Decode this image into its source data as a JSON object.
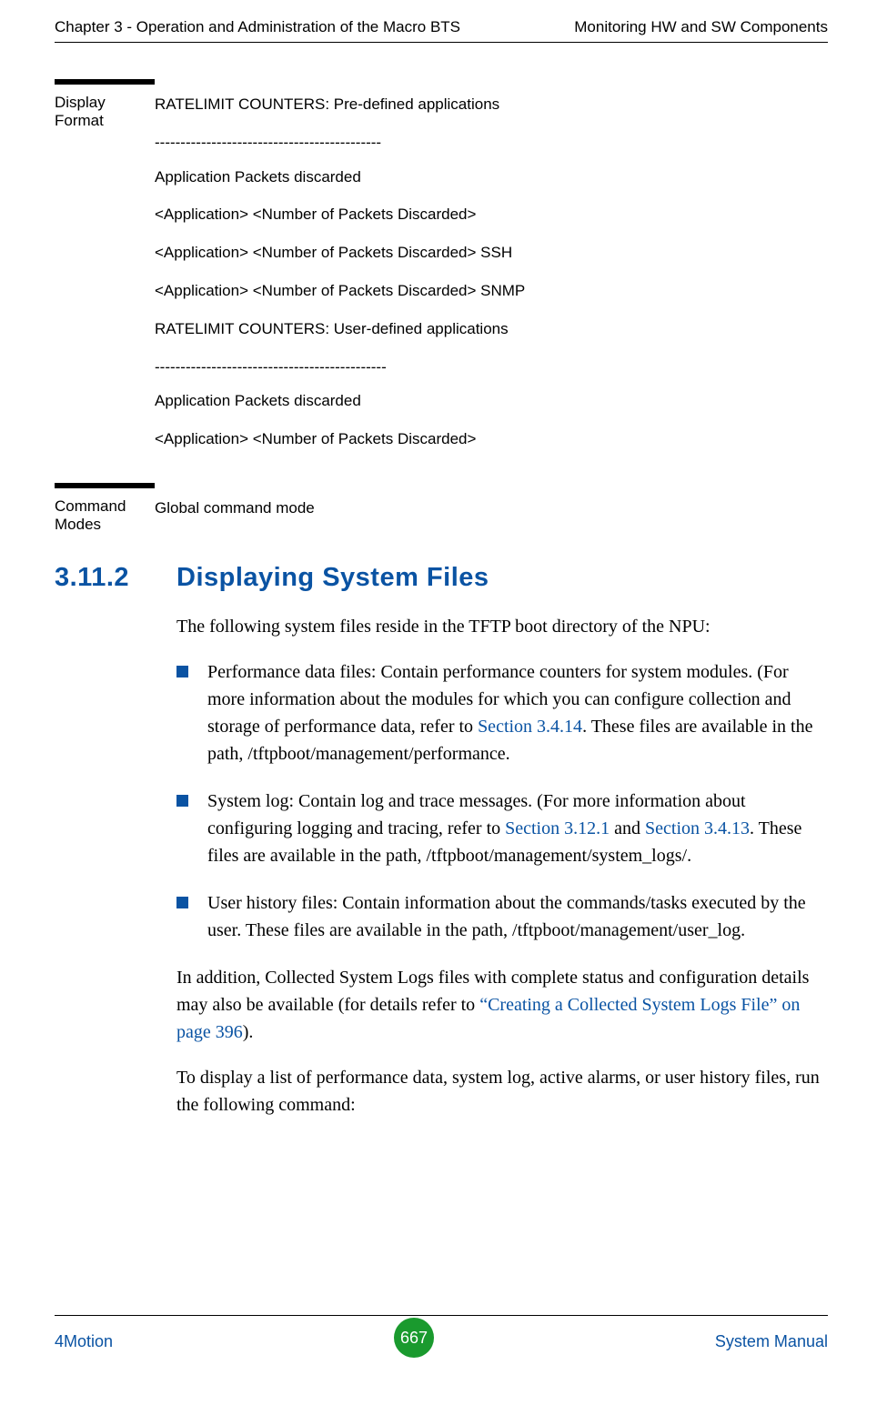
{
  "header": {
    "left": "Chapter 3 - Operation and Administration of the Macro BTS",
    "right": "Monitoring HW and SW Components"
  },
  "display_format": {
    "label": "Display Format",
    "lines": [
      "RATELIMIT COUNTERS: Pre-defined applications",
      "--------------------------------------------",
      "Application     Packets discarded",
      " <Application>    <Number of Packets Discarded>",
      "<Application>    <Number of Packets Discarded> SSH",
      "<Application>     <Number of Packets Discarded> SNMP",
      "RATELIMIT COUNTERS: User-defined applications",
      "---------------------------------------------",
      "Application    Packets discarded",
      "<Application>   <Number of Packets Discarded>"
    ]
  },
  "command_modes": {
    "label": "Command Modes",
    "value": "Global command mode"
  },
  "heading": {
    "number": "3.11.2",
    "title": "Displaying System Files"
  },
  "body": {
    "intro": "The following system files reside in the TFTP boot directory of the NPU:",
    "bullets": [
      {
        "pre": "Performance data files: Contain performance counters for system modules. (For more information about the modules for which you can configure collection and storage of performance data, refer to ",
        "link": "Section 3.4.14",
        "post": ". These files are available in the path, /tftpboot/management/performance."
      },
      {
        "pre": "System log: Contain log and trace messages. (For more information about configuring logging and tracing, refer to ",
        "link": "Section 3.12.1",
        "mid": " and ",
        "link2": "Section 3.4.13",
        "post": ". These files are available in the path, /tftpboot/management/system_logs/."
      },
      {
        "pre": "User history files: Contain information about the commands/tasks executed by the user. These files are available in the path, /tftpboot/management/user_log.",
        "link": "",
        "post": ""
      }
    ],
    "para2_pre": "In addition, Collected System Logs files with complete status and configuration details may also be available (for details refer to ",
    "para2_link": "“Creating a Collected System Logs File” on page 396",
    "para2_post": ").",
    "para3": "To display a list of performance data, system log, active alarms, or user history files, run the following command:"
  },
  "footer": {
    "left": "4Motion",
    "center": "667",
    "right": "System Manual"
  }
}
